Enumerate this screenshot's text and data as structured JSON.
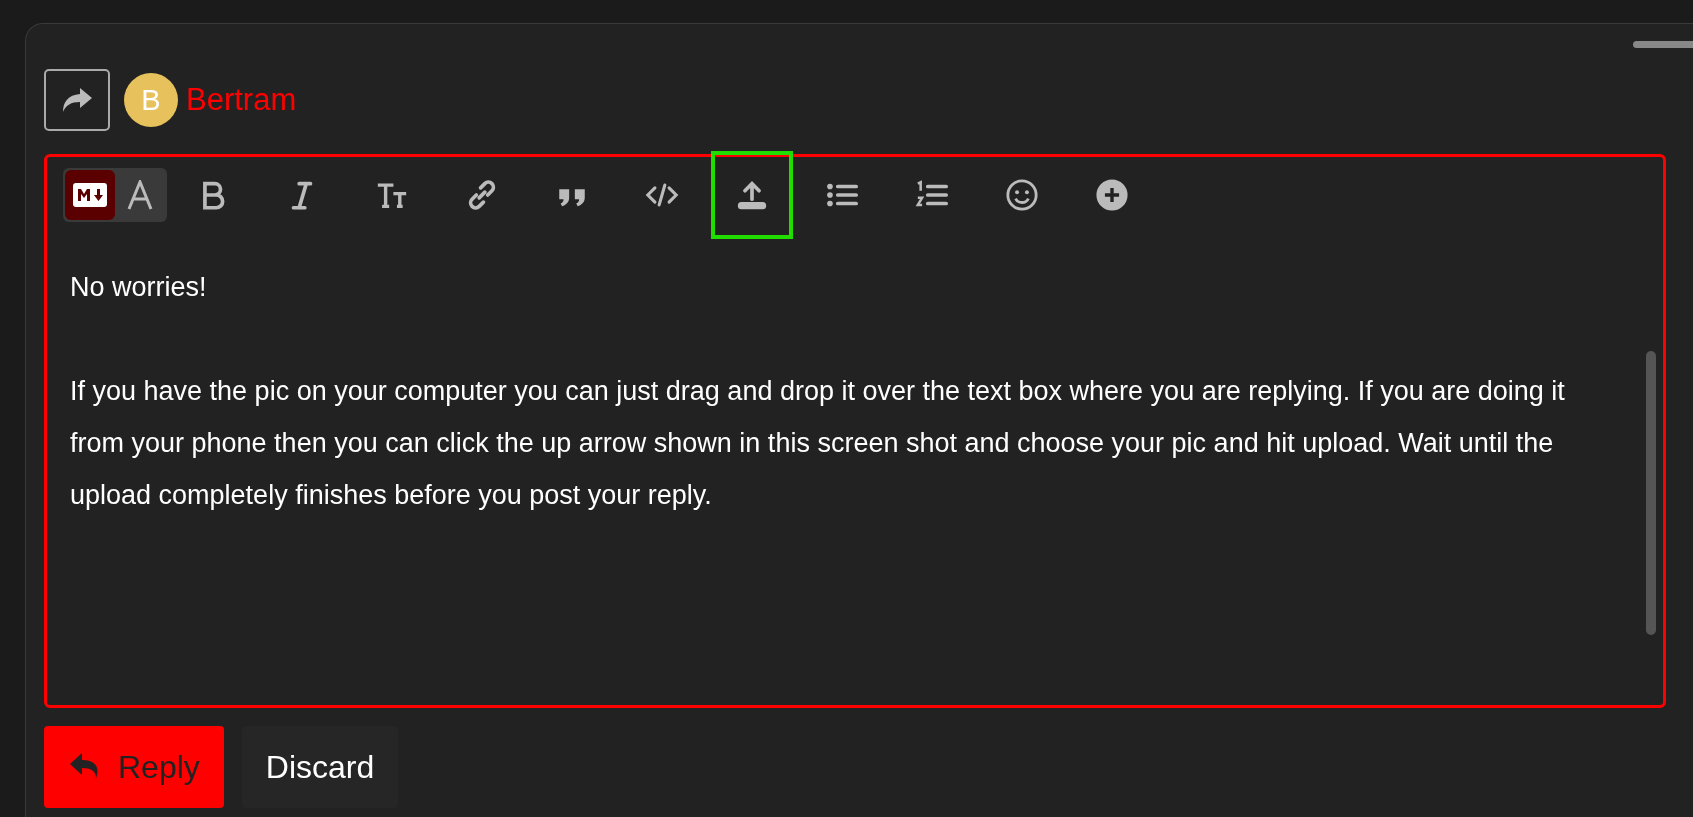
{
  "composer": {
    "author": {
      "initial": "B",
      "name": "Bertram"
    },
    "mode_toggle": [
      {
        "kind": "markdown",
        "selected": true
      },
      {
        "kind": "rich",
        "selected": false
      }
    ],
    "toolbar": [
      {
        "kind": "bold",
        "highlighted": false
      },
      {
        "kind": "italic",
        "highlighted": false
      },
      {
        "kind": "heading",
        "highlighted": false
      },
      {
        "kind": "link",
        "highlighted": false
      },
      {
        "kind": "quote",
        "highlighted": false
      },
      {
        "kind": "code",
        "highlighted": false
      },
      {
        "kind": "upload",
        "highlighted": true
      },
      {
        "kind": "bullets",
        "highlighted": false
      },
      {
        "kind": "numbers",
        "highlighted": false
      },
      {
        "kind": "emoji",
        "highlighted": false
      },
      {
        "kind": "more",
        "highlighted": false
      }
    ],
    "paragraphs": [
      "No worries!",
      "If you have the pic on your computer you can just drag and drop it over the text box where you are replying.  If you are doing it from your phone then you can click the up arrow shown in this screen shot and choose your pic and hit upload.  Wait until the upload completely finishes before you post your reply."
    ],
    "buttons": [
      {
        "kind": "primary",
        "label": "Reply"
      },
      {
        "kind": "secondary",
        "label": "Discard"
      }
    ]
  }
}
